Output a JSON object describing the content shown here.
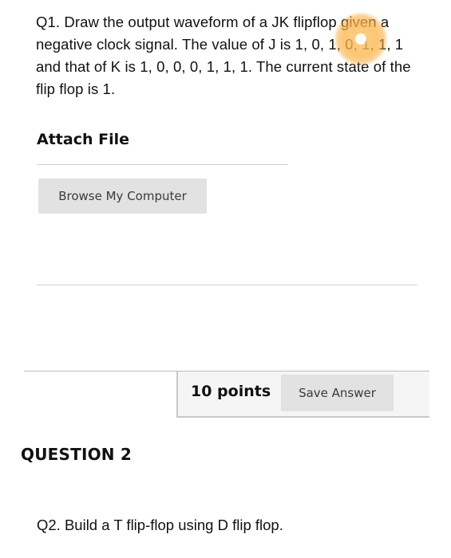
{
  "question1": {
    "text": "Q1. Draw the output waveform of a JK flipflop given a negative clock signal. The value of J is 1, 0, 1, 0, 1, 1, 1 and that of K is 1, 0, 0, 0, 1, 1, 1. The current state of the flip flop is 1."
  },
  "attach": {
    "title": "Attach File",
    "browse_label": "Browse My Computer"
  },
  "footer": {
    "points": "10 points",
    "save_label": "Save Answer"
  },
  "question2": {
    "heading": "QUESTION 2",
    "text": "Q2. Build a T flip-flop using D flip flop."
  },
  "colors": {
    "button_bg": "#e2e2e2",
    "footer_bg": "#f5f5f5",
    "tap_highlight": "#f7b24a"
  }
}
